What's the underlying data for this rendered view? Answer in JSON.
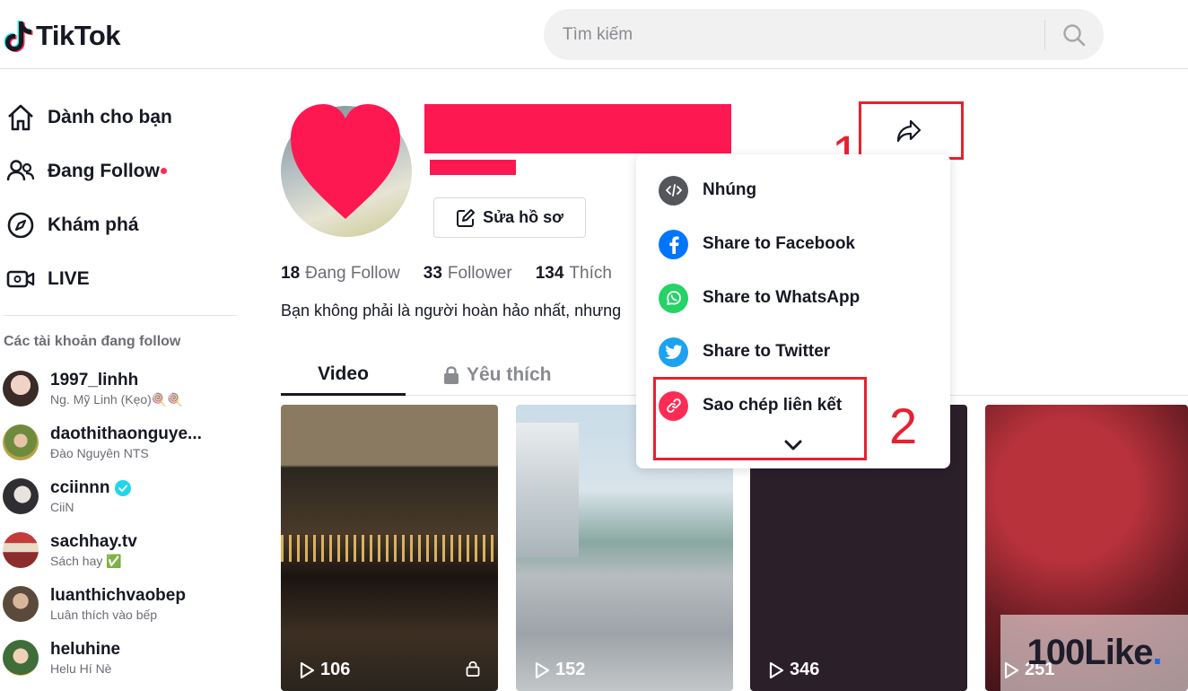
{
  "header": {
    "logo_text": "TikTok",
    "search_placeholder": "Tìm kiếm"
  },
  "sidebar": {
    "nav": [
      {
        "label": "Dành cho bạn",
        "icon": "home-icon"
      },
      {
        "label": "Đang Follow",
        "icon": "following-icon",
        "dot": true
      },
      {
        "label": "Khám phá",
        "icon": "compass-icon"
      },
      {
        "label": "LIVE",
        "icon": "live-icon"
      }
    ],
    "following_title": "Các tài khoản đang follow",
    "accounts": [
      {
        "name": "1997_linhh",
        "sub": "Ng. Mỹ Linh (Kẹo)🍭🍭",
        "verified": false
      },
      {
        "name": "daothithaonguye...",
        "sub": "Đào Nguyên NTS",
        "verified": false
      },
      {
        "name": "cciinnn",
        "sub": "CiiN",
        "verified": true
      },
      {
        "name": "sachhay.tv",
        "sub": "Sách hay ✅",
        "verified": false
      },
      {
        "name": "luanthichvaobep",
        "sub": "Luân thích vào bếp",
        "verified": false
      },
      {
        "name": "heluhine",
        "sub": "Helu Hí Nè",
        "verified": false
      }
    ]
  },
  "profile": {
    "edit_label": "Sửa hồ sơ",
    "stats": [
      {
        "num": "18",
        "label": "Đang Follow"
      },
      {
        "num": "33",
        "label": "Follower"
      },
      {
        "num": "134",
        "label": "Thích"
      }
    ],
    "bio": "Bạn không phải là người hoàn hảo nhất, nhưng"
  },
  "tabs": {
    "video": "Video",
    "liked": "Yêu thích"
  },
  "videos": [
    {
      "views": "106",
      "locked": true
    },
    {
      "views": "152",
      "locked": false
    },
    {
      "views": "346",
      "locked": false
    },
    {
      "views": "251",
      "locked": false
    }
  ],
  "share_menu": {
    "items": [
      {
        "label": "Nhúng",
        "icon": "embed-icon",
        "color": "#161823"
      },
      {
        "label": "Share to Facebook",
        "icon": "facebook-icon",
        "color": "#0075fa"
      },
      {
        "label": "Share to WhatsApp",
        "icon": "whatsapp-icon",
        "color": "#25d366"
      },
      {
        "label": "Share to Twitter",
        "icon": "twitter-icon",
        "color": "#1da1f2"
      },
      {
        "label": "Sao chép liên kết",
        "icon": "link-icon",
        "color": "#fe2c55"
      }
    ]
  },
  "annotations": {
    "step1": "1",
    "step2": "2",
    "color": "#e8212f"
  },
  "watermark": {
    "text": "100Like",
    "dot": "."
  }
}
